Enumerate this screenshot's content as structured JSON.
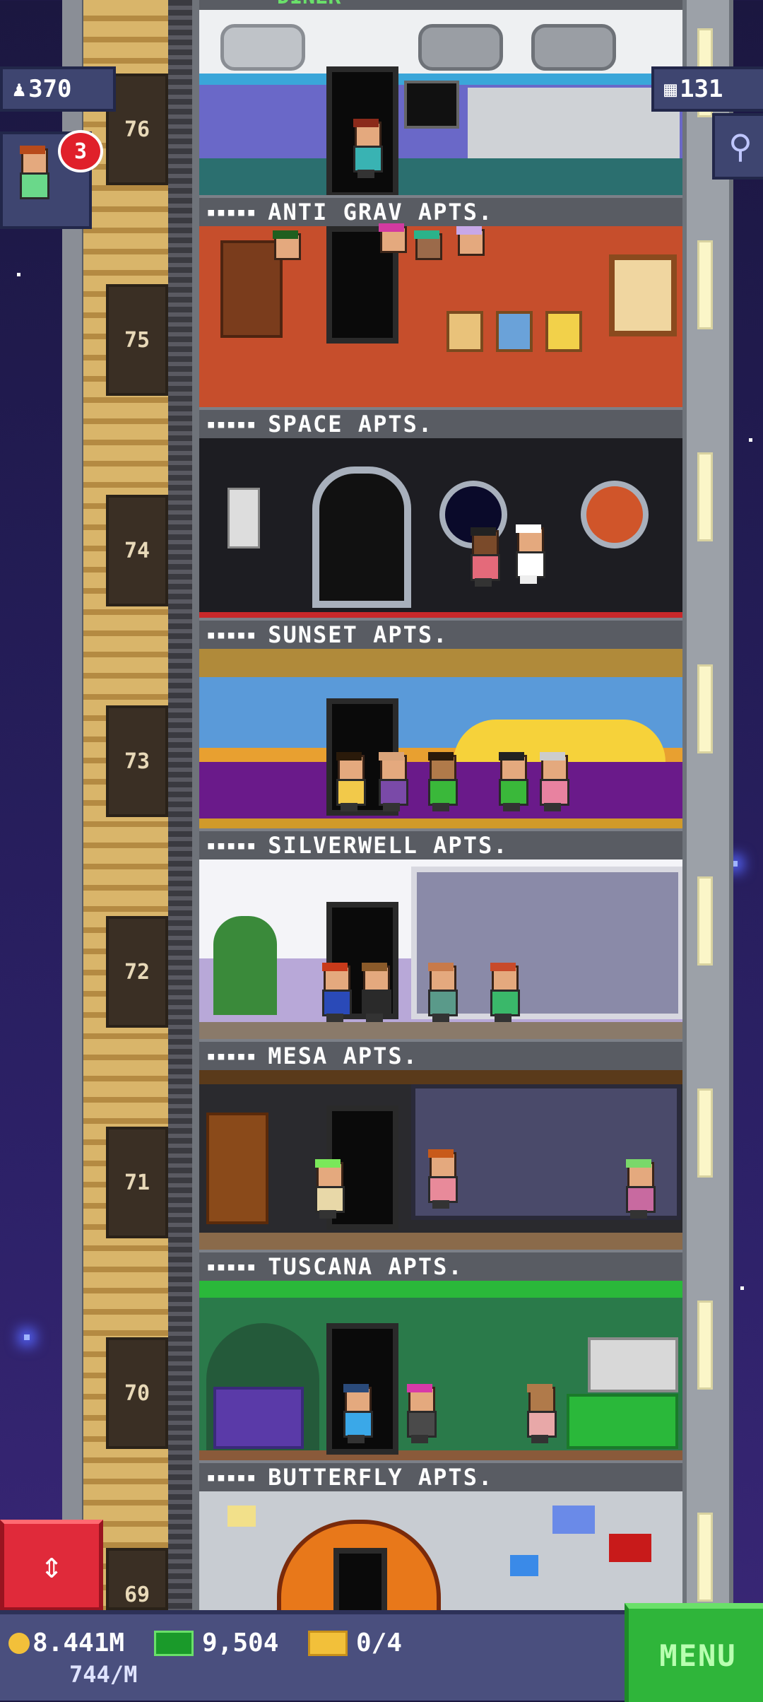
{
  "hud": {
    "population": "370",
    "population_icon": "person-icon",
    "floors_count": "131",
    "floors_icon": "building-icon",
    "search_icon": "magnifier-icon",
    "notification_count": "3"
  },
  "top_floor_partial_label": "DINER",
  "floors": [
    {
      "number": "76",
      "name": "ANTI GRAV APTS.",
      "stars": "▪▪▪▪▪"
    },
    {
      "number": "75",
      "name": "SPACE APTS.",
      "stars": "▪▪▪▪▪"
    },
    {
      "number": "74",
      "name": "SUNSET APTS.",
      "stars": "▪▪▪▪▪"
    },
    {
      "number": "73",
      "name": "SILVERWELL APTS.",
      "stars": "▪▪▪▪▪"
    },
    {
      "number": "72",
      "name": "MESA APTS.",
      "stars": "▪▪▪▪▪"
    },
    {
      "number": "71",
      "name": "TUSCANA APTS.",
      "stars": "▪▪▪▪▪"
    },
    {
      "number": "70",
      "name": "BUTTERFLY APTS.",
      "stars": "▪▪▪▪▪"
    },
    {
      "number": "69",
      "name": "",
      "stars": ""
    }
  ],
  "bottom": {
    "coins": "8.441M",
    "coins_rate": "744/M",
    "bux": "9,504",
    "tickets": "0/4",
    "menu_label": "MENU"
  },
  "colors": {
    "menu_green": "#2fb53a",
    "elevator_red": "#e02a3a",
    "label_gray": "#595c63"
  }
}
